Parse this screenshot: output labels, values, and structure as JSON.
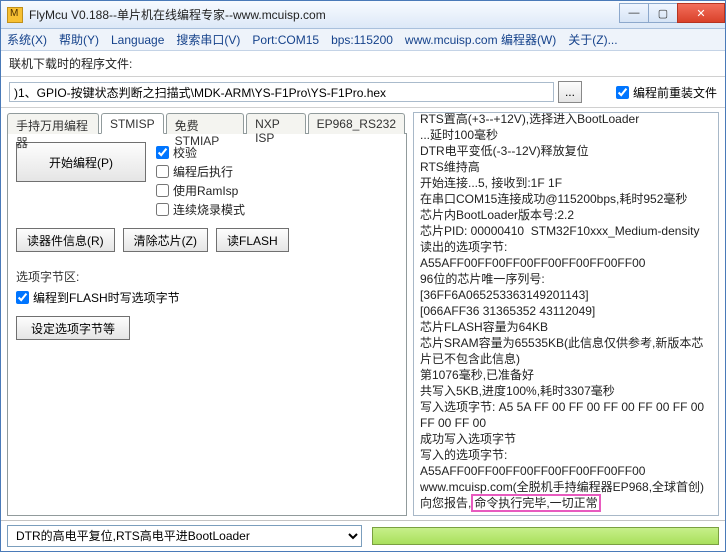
{
  "window": {
    "title": "FlyMcu V0.188--单片机在线编程专家--www.mcuisp.com"
  },
  "menu": {
    "system": "系统(X)",
    "help": "帮助(Y)",
    "language": "Language",
    "search_port": "搜索串口(V)",
    "port": "Port:COM15",
    "bps": "bps:115200",
    "site": "www.mcuisp.com 编程器(W)",
    "about": "关于(Z)..."
  },
  "toolbar": {
    "label": "联机下载时的程序文件:",
    "path": ")1、GPIO-按键状态判断之扫描式\\MDK-ARM\\YS-F1Pro\\YS-F1Pro.hex",
    "browse": "...",
    "reinstall": "编程前重装文件"
  },
  "tabs": {
    "t1": "手持万用编程器",
    "t2": "STMISP",
    "t3": "免费STMIAP",
    "t4": "NXP ISP",
    "t5": "EP968_RS232"
  },
  "panel": {
    "start": "开始编程(P)",
    "chk_verify": "校验",
    "chk_runafter": "编程后执行",
    "chk_ramisp": "使用RamIsp",
    "chk_cont": "连续烧录模式",
    "btn_readinfo": "读器件信息(R)",
    "btn_clear": "清除芯片(Z)",
    "btn_readflash": "读FLASH",
    "opt_title": "选项字节区:",
    "opt_chk": "编程到FLASH时写选项字节",
    "opt_btn": "设定选项字节等"
  },
  "log_lines": [
    "RTS置高(+3--+12V),选择进入BootLoader",
    "...延时100毫秒",
    "DTR电平变低(-3--12V)释放复位",
    "RTS维持高",
    "开始连接...5, 接收到:1F 1F",
    "在串口COM15连接成功@115200bps,耗时952毫秒",
    "芯片内BootLoader版本号:2.2",
    "芯片PID: 00000410  STM32F10xxx_Medium-density",
    "读出的选项字节:",
    "A55AFF00FF00FF00FF00FF00FF00FF00",
    "96位的芯片唯一序列号:",
    "[36FF6A065253363149201143]",
    "[066AFF36 31365352 43112049]",
    "芯片FLASH容量为64KB",
    "芯片SRAM容量为65535KB(此信息仅供参考,新版本芯片已不包含此信息)",
    "第1076毫秒,已准备好",
    "共写入5KB,进度100%,耗时3307毫秒",
    "写入选项字节: A5 5A FF 00 FF 00 FF 00 FF 00 FF 00 FF 00 FF 00",
    "成功写入选项字节",
    "写入的选项字节:",
    "A55AFF00FF00FF00FF00FF00FF00FF00"
  ],
  "log_tail_prefix": "www.mcuisp.com(全脱机手持编程器EP968,全球首创)向您报告,",
  "log_tail_hl": "命令执行完毕,一切正常",
  "bottom": {
    "select": "DTR的高电平复位,RTS高电平进BootLoader"
  }
}
